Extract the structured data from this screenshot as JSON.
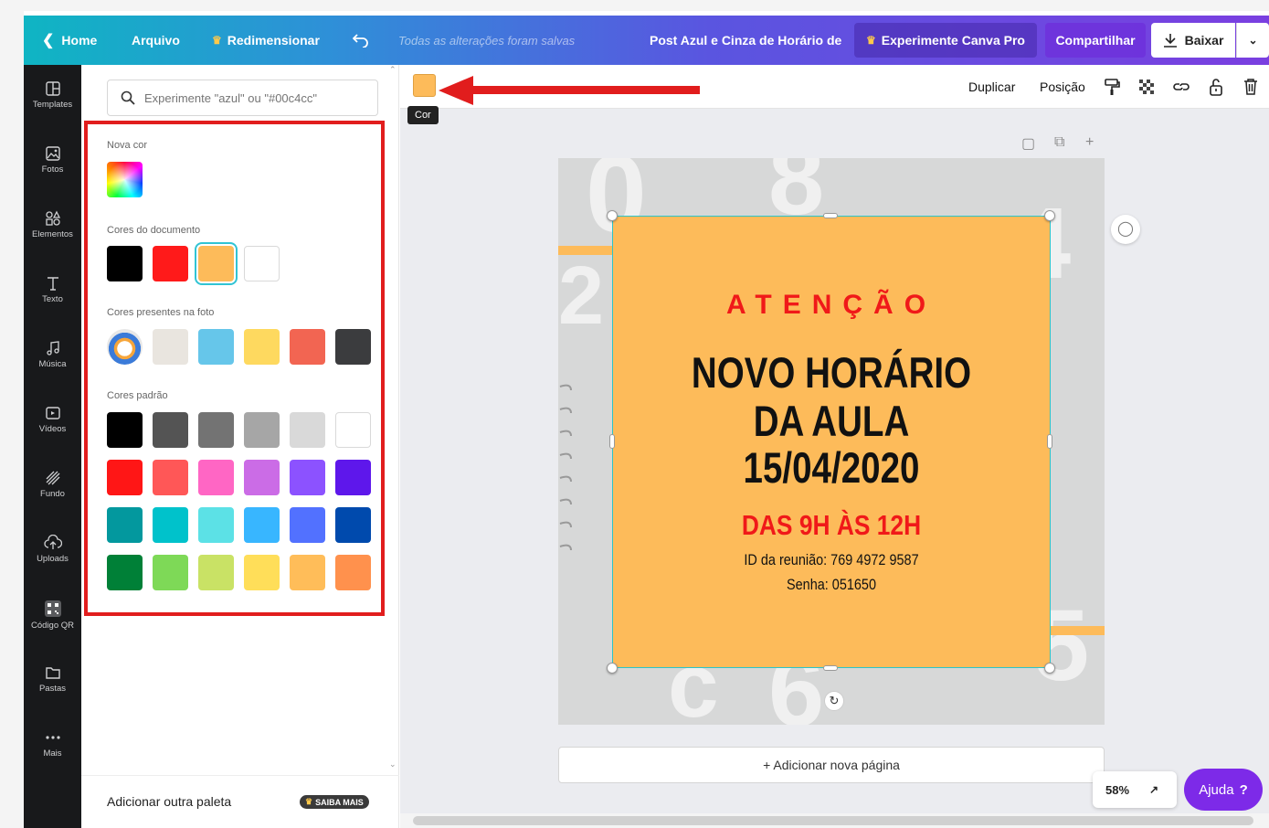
{
  "topbar": {
    "home": "Home",
    "file": "Arquivo",
    "resize": "Redimensionar",
    "saved_status": "Todas as alterações foram salvas",
    "doc_title": "Post Azul e Cinza de Horário de",
    "try_pro": "Experimente Canva Pro",
    "share": "Compartilhar",
    "download": "Baixar"
  },
  "sidebar": {
    "items": [
      {
        "label": "Templates",
        "icon": "templates-icon"
      },
      {
        "label": "Fotos",
        "icon": "photos-icon"
      },
      {
        "label": "Elementos",
        "icon": "elements-icon"
      },
      {
        "label": "Texto",
        "icon": "text-icon"
      },
      {
        "label": "Música",
        "icon": "music-icon"
      },
      {
        "label": "Vídeos",
        "icon": "videos-icon"
      },
      {
        "label": "Fundo",
        "icon": "background-icon"
      },
      {
        "label": "Uploads",
        "icon": "uploads-icon"
      },
      {
        "label": "Código QR",
        "icon": "qr-code-icon"
      },
      {
        "label": "Pastas",
        "icon": "folders-icon"
      },
      {
        "label": "Mais",
        "icon": "more-icon"
      }
    ]
  },
  "color_panel": {
    "search_placeholder": "Experimente \"azul\" ou \"#00c4cc\"",
    "new_color_label": "Nova cor",
    "document_colors_label": "Cores do documento",
    "document_colors": [
      "#000000",
      "#ff1a1a",
      "#fdbb5a",
      "#ffffff"
    ],
    "photo_colors_label": "Cores presentes na foto",
    "photo_colors": [
      "#e9e5df",
      "#66c6ea",
      "#fed95f",
      "#f26552",
      "#3b3c3e"
    ],
    "default_colors_label": "Cores padrão",
    "default_colors": [
      [
        "#000000",
        "#545454",
        "#737373",
        "#a6a6a6",
        "#d9d9d9",
        "#ffffff"
      ],
      [
        "#ff1616",
        "#ff5757",
        "#ff66c4",
        "#cb6ce6",
        "#8c52ff",
        "#5e17eb"
      ],
      [
        "#03989e",
        "#00c2cb",
        "#5ce1e6",
        "#38b6ff",
        "#5271ff",
        "#004aad"
      ],
      [
        "#008037",
        "#7ed957",
        "#c9e265",
        "#ffde59",
        "#ffbd59",
        "#ff914d"
      ]
    ],
    "add_palette": "Adicionar outra paleta",
    "learn_more": "SAIBA MAIS"
  },
  "context_toolbar": {
    "color_tooltip": "Cor",
    "duplicate": "Duplicar",
    "position": "Posição"
  },
  "design": {
    "attention": "ATENÇÃO",
    "line1": "NOVO HORÁRIO",
    "line2": "DA AULA",
    "line3": "15/04/2020",
    "hours": "DAS 9H ÀS 12H",
    "meeting_id": "ID da reunião: 769 4972 9587",
    "password": "Senha: 051650",
    "card_color": "#fdbb5a",
    "accent_red": "#f01919"
  },
  "add_page": "+ Adicionar nova página",
  "zoom_level": "58%",
  "help": "Ajuda"
}
